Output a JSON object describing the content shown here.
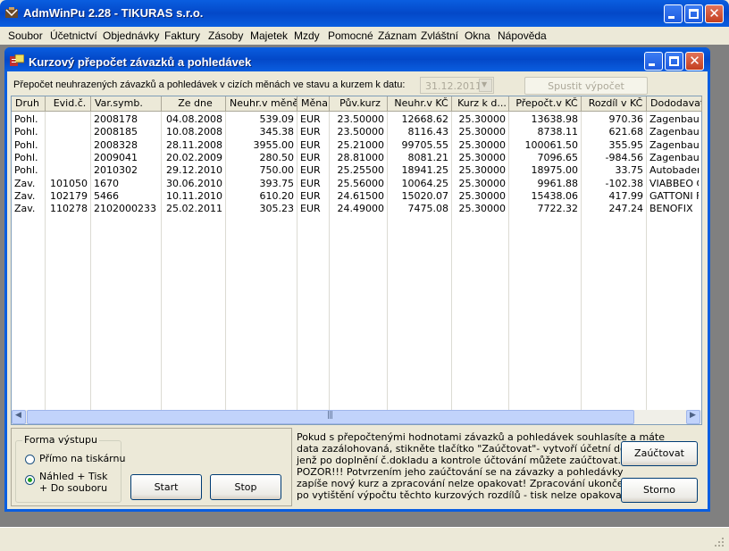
{
  "window": {
    "title": "AdmWinPu 2.28 - TIKURAS  s.r.o."
  },
  "menu": [
    "Soubor",
    "Účetnictví",
    "Objednávky",
    "Faktury",
    "Zásoby",
    "Majetek",
    "Mzdy",
    "Pomocné",
    "Záznam",
    "Zvláštní",
    "Okna",
    "Nápověda"
  ],
  "dialog": {
    "title": "Kurzový přepočet závazků a pohledávek",
    "description": "Přepočet neuhrazených závazků a pohledávek v cizích měnách ve stavu a kurzem k datu:",
    "date_value": "31.12.2011",
    "run_button": "Spustit výpočet"
  },
  "table": {
    "columns": [
      "Druh",
      "Evid.č.",
      "Var.symb.",
      "Ze dne",
      "Neuhr.v měně",
      "Měna",
      "Pův.kurz",
      "Neuhr.v KČ",
      "Kurz k d...",
      "Přepočt.v KČ",
      "Rozdíl v KČ",
      "Dododavat"
    ],
    "rows": [
      [
        "Pohl.",
        "",
        "2008178",
        "04.08.2008",
        "539.09",
        "EUR",
        "23.50000",
        "12668.62",
        "25.30000",
        "13638.98",
        "970.36",
        "Zagenbaun"
      ],
      [
        "Pohl.",
        "",
        "2008185",
        "10.08.2008",
        "345.38",
        "EUR",
        "23.50000",
        "8116.43",
        "25.30000",
        "8738.11",
        "621.68",
        "Zagenbaun"
      ],
      [
        "Pohl.",
        "",
        "2008328",
        "28.11.2008",
        "3955.00",
        "EUR",
        "25.21000",
        "99705.55",
        "25.30000",
        "100061.50",
        "355.95",
        "Zagenbaun"
      ],
      [
        "Pohl.",
        "",
        "2009041",
        "20.02.2009",
        "280.50",
        "EUR",
        "28.81000",
        "8081.21",
        "25.30000",
        "7096.65",
        "-984.56",
        "Zagenbaun"
      ],
      [
        "Pohl.",
        "",
        "2010302",
        "29.12.2010",
        "750.00",
        "EUR",
        "25.25500",
        "18941.25",
        "25.30000",
        "18975.00",
        "33.75",
        "Autobaden"
      ],
      [
        "Zav.",
        "101050",
        "1670",
        "30.06.2010",
        "393.75",
        "EUR",
        "25.56000",
        "10064.25",
        "25.30000",
        "9961.88",
        "-102.38",
        "VIABBEO C"
      ],
      [
        "Zav.",
        "102179",
        "5466",
        "10.11.2010",
        "610.20",
        "EUR",
        "24.61500",
        "15020.07",
        "25.30000",
        "15438.06",
        "417.99",
        "GATTONI F"
      ],
      [
        "Zav.",
        "110278",
        "2102000233",
        "25.02.2011",
        "305.23",
        "EUR",
        "24.49000",
        "7475.08",
        "25.30000",
        "7722.32",
        "247.24",
        "BENOFIX"
      ]
    ]
  },
  "output_form": {
    "title": "Forma výstupu",
    "option1": "Přímo na tiskárnu",
    "option2_line1": "Náhled + Tisk",
    "option2_line2": "+ Do souboru",
    "selected": "option2"
  },
  "buttons": {
    "start": "Start",
    "stop": "Stop",
    "post": "Zaúčtovat",
    "cancel": "Storno"
  },
  "notice": [
    "Pokud s přepočtenými hodnotami závazků a pohledávek souhlasíte a máte",
    "data zazálohovaná, stikněte tlačítko \"Zaúčtovat\"- vytvoří účetní doklad,",
    "jenž po doplnění č.dokladu a kontrole účtování můžete zaúčtovat.",
    "POZOR!!! Potvrzením jeho zaúčtování se na závazky a pohledávky",
    "zapíše nový kurz a zpracování nelze opakovat! Zpracování ukončete až",
    "po vytištění výpočtu těchto kurzových rozdílů - tisk nelze opakovat!"
  ],
  "colors": {
    "titlebar": "#0a5ee0",
    "face": "#ece9d8",
    "grid_border": "#7f9db9"
  }
}
